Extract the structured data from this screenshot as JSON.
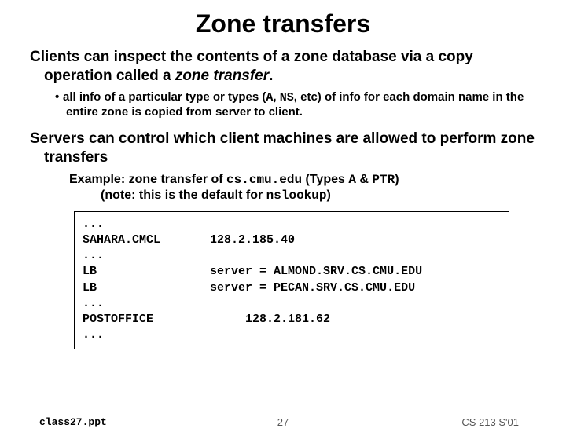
{
  "title": "Zone transfers",
  "para1_a": "Clients can inspect the contents of a zone database via a copy operation called a ",
  "para1_b": "zone transfer",
  "para1_c": ".",
  "bullet1_a": "all info of a particular type or types (",
  "bullet1_b": "A",
  "bullet1_c": ", ",
  "bullet1_d": "NS",
  "bullet1_e": ", etc) of info for each domain name in the entire zone is copied from server to client.",
  "para2": "Servers can control which client machines are allowed to perform zone transfers",
  "example_a": "Example: zone transfer of ",
  "example_b": "cs.cmu.edu",
  "example_c": " (Types ",
  "example_d": "A",
  "example_e": " & ",
  "example_f": "PTR",
  "example_g": ")",
  "example_line2_a": "(note: this is the default for ",
  "example_line2_b": "nslookup",
  "example_line2_c": ")",
  "codebox": "...\nSAHARA.CMCL       128.2.185.40\n...\nLB                server = ALMOND.SRV.CS.CMU.EDU\nLB                server = PECAN.SRV.CS.CMU.EDU\n...\nPOSTOFFICE             128.2.181.62\n...",
  "footer": {
    "filename": "class27.ppt",
    "page": "– 27 –",
    "course": "CS 213 S'01"
  }
}
